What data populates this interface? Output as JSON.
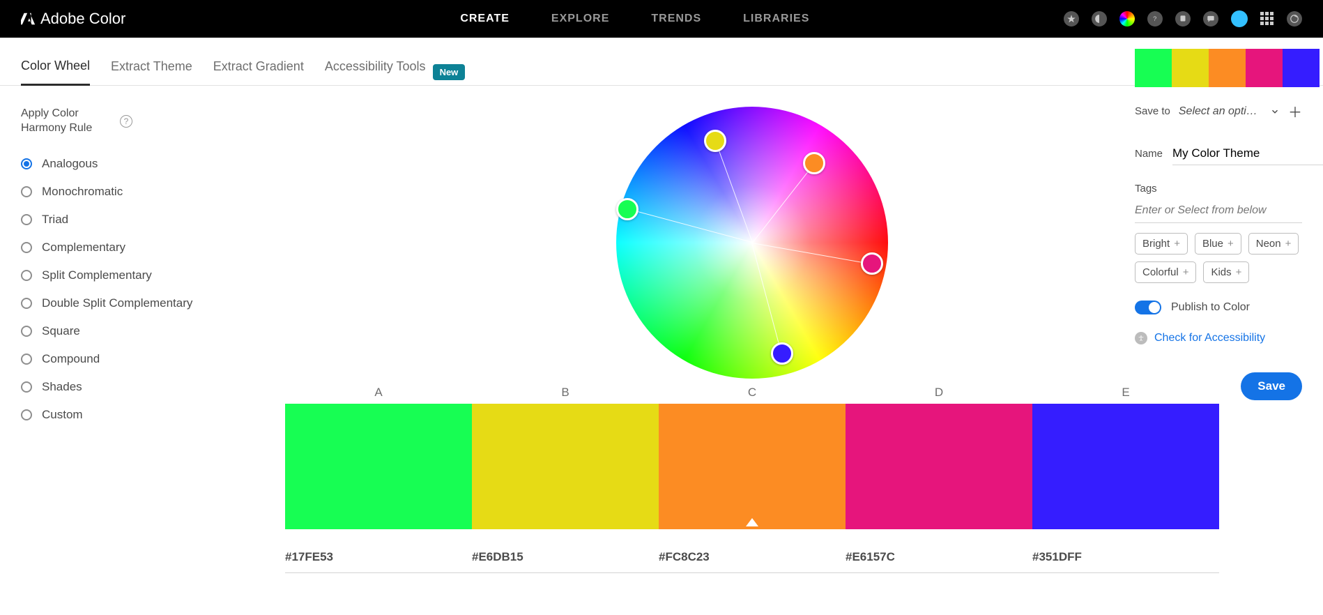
{
  "app_title": "Adobe Color",
  "top_nav": [
    "CREATE",
    "EXPLORE",
    "TRENDS",
    "LIBRARIES"
  ],
  "top_nav_active": 0,
  "sub_tabs": [
    "Color Wheel",
    "Extract Theme",
    "Extract Gradient",
    "Accessibility Tools"
  ],
  "sub_tabs_active": 0,
  "sub_tabs_badge": "New",
  "left": {
    "title": "Apply Color Harmony Rule",
    "rules": [
      "Analogous",
      "Monochromatic",
      "Triad",
      "Complementary",
      "Split Complementary",
      "Double Split Complementary",
      "Square",
      "Compound",
      "Shades",
      "Custom"
    ],
    "rule_selected": 0
  },
  "swatches": {
    "letters": [
      "A",
      "B",
      "C",
      "D",
      "E"
    ],
    "colors": [
      "#17FE53",
      "#E6DB15",
      "#FC8C23",
      "#E6157C",
      "#351DFF"
    ],
    "hex": [
      "#17FE53",
      "#E6DB15",
      "#FC8C23",
      "#E6157C",
      "#351DFF"
    ],
    "selected": 2
  },
  "wheel_markers": [
    {
      "angle": 165,
      "radius": 185,
      "color": "#17FE53"
    },
    {
      "angle": 110,
      "radius": 155,
      "color": "#E6DB15"
    },
    {
      "angle": 52,
      "radius": 145,
      "color": "#FC8C23"
    },
    {
      "angle": -10,
      "radius": 175,
      "color": "#E6157C"
    },
    {
      "angle": -75,
      "radius": 165,
      "color": "#351DFF"
    }
  ],
  "right": {
    "save_to_label": "Save to",
    "save_to_value": "Select an opti…",
    "name_label": "Name",
    "name_value": "My Color Theme",
    "tags_label": "Tags",
    "tags_placeholder": "Enter or Select from below",
    "tag_suggestions": [
      "Bright",
      "Blue",
      "Neon",
      "Colorful",
      "Kids"
    ],
    "publish_label": "Publish to Color",
    "publish_on": true,
    "accessibility_link": "Check for Accessibility",
    "save_label": "Save"
  }
}
